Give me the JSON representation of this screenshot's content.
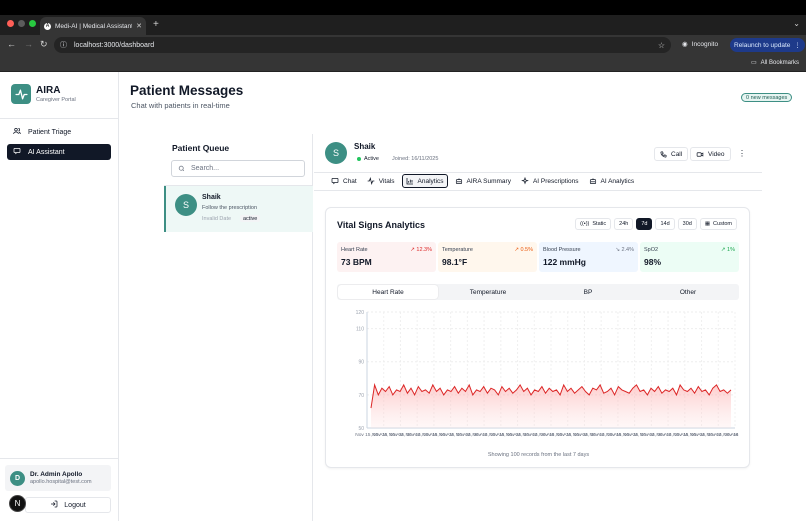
{
  "browser": {
    "tab_title": "Medi-AI | Medical Assistant D",
    "favicon_char": "A",
    "url": "localhost:3000/dashboard",
    "incognito_label": "Incognito",
    "relaunch_label": "Relaunch to update",
    "bookmarks_label": "All Bookmarks",
    "traffic_colors": [
      "#ff5f57",
      "#febc2e",
      "#28c840"
    ]
  },
  "sidebar": {
    "brand_name": "AIRA",
    "brand_sub": "Caregiver Portal",
    "items": [
      {
        "label": "Patient Triage",
        "icon": "users-icon",
        "active": false
      },
      {
        "label": "AI Assistant",
        "icon": "message-square-icon",
        "active": true
      }
    ],
    "user": {
      "initial": "D",
      "name": "Dr. Admin Apollo",
      "email": "apollo.hospital@test.com"
    },
    "logout_label": "Logout",
    "n_badge": "N"
  },
  "header": {
    "title": "Patient Messages",
    "subtitle": "Chat with patients in real-time",
    "new_messages": "0 new messages"
  },
  "queue": {
    "title": "Patient Queue",
    "search_placeholder": "Search...",
    "items": [
      {
        "initial": "S",
        "name": "Shaik",
        "message": "Follow the prescription",
        "date": "Invalid Date",
        "status": "active"
      }
    ]
  },
  "patient": {
    "initial": "S",
    "name": "Shaik",
    "status": "Active",
    "joined": "Joined: 16/11/2025",
    "call_label": "Call",
    "video_label": "Video"
  },
  "tabs": [
    {
      "label": "Chat",
      "icon": "chat-icon",
      "active": false
    },
    {
      "label": "Vitals",
      "icon": "activity-icon",
      "active": false
    },
    {
      "label": "Analytics",
      "icon": "bar-chart-icon",
      "active": true
    },
    {
      "label": "AIRA Summary",
      "icon": "bot-icon",
      "active": false
    },
    {
      "label": "AI Prescriptions",
      "icon": "sparkles-icon",
      "active": false
    },
    {
      "label": "AI Analytics",
      "icon": "bot-icon",
      "active": false
    }
  ],
  "analytics": {
    "title": "Vital Signs Analytics",
    "ranges": [
      {
        "label": "Static",
        "active": false
      },
      {
        "label": "24h",
        "active": false
      },
      {
        "label": "7d",
        "active": true
      },
      {
        "label": "14d",
        "active": false
      },
      {
        "label": "30d",
        "active": false
      },
      {
        "label": "Custom",
        "active": false
      }
    ],
    "metrics": [
      {
        "label": "Heart Rate",
        "change": "12.3%",
        "value": "73 BPM",
        "bg": "#fdf2f2",
        "change_color": "#dc2626",
        "trend": "up"
      },
      {
        "label": "Temperature",
        "change": "0.5%",
        "value": "98.1°F",
        "bg": "#fff7ed",
        "change_color": "#ea580c",
        "trend": "up"
      },
      {
        "label": "Blood Pressure",
        "change": "2.4%",
        "value": "122 mmHg",
        "bg": "#eff6ff",
        "change_color": "#6b7280",
        "trend": "down"
      },
      {
        "label": "SpO2",
        "change": "1%",
        "value": "98%",
        "bg": "#ecfdf5",
        "change_color": "#16a34a",
        "trend": "up"
      }
    ],
    "vital_tabs": [
      {
        "label": "Heart Rate",
        "active": true
      },
      {
        "label": "Temperature",
        "active": false
      },
      {
        "label": "BP",
        "active": false
      },
      {
        "label": "Other",
        "active": false
      }
    ],
    "footer": "Showing 100 records from the last 7 days"
  },
  "chart_data": {
    "type": "area",
    "series": [
      {
        "name": "",
        "color": "#dc2626",
        "values": [
          62,
          76,
          70,
          74,
          72,
          75,
          70,
          73,
          72,
          76,
          71,
          74,
          70,
          75,
          72,
          73,
          71,
          76,
          72,
          74,
          70,
          73,
          72,
          75,
          71,
          74,
          72,
          76,
          70,
          73,
          72,
          75,
          71,
          74,
          73,
          70,
          75,
          72,
          74,
          71,
          73,
          76,
          72,
          74,
          70,
          73,
          72,
          75,
          71,
          74,
          72,
          73,
          70,
          76,
          72,
          74,
          71,
          73,
          75,
          72,
          70,
          74,
          73,
          76,
          71,
          72,
          74,
          70,
          75,
          73,
          72,
          71,
          74,
          76,
          72,
          73,
          70,
          74,
          72,
          75,
          71,
          73,
          72,
          74,
          70,
          76,
          73,
          72,
          74,
          71,
          75,
          72,
          73,
          70,
          74,
          76,
          72,
          73,
          71,
          73
        ]
      }
    ],
    "ylim": [
      50,
      120
    ],
    "yticks": [
      50,
      70,
      90,
      110,
      120
    ],
    "xtick_labels": [
      "Nov 15, 05 AM",
      "Nov 15, 05 AM",
      "Nov 15, 05 AM",
      "Nov 15, 05 AM",
      "Nov 15, 05 AM",
      "Nov 15, 05 AM",
      "Nov 15, 05 AM",
      "Nov 15, 05 AM",
      "Nov 15, 05 AM",
      "Nov 15, 05 AM",
      "Nov 15, 05 AM",
      "Nov 15, 05 AM",
      "Nov 15, 05 AM",
      "Nov 15, 05 AM",
      "Nov 15, 05 AM",
      "Nov 15, 05 AM",
      "Nov 15, 05 AM",
      "Nov 15, 05 AM",
      "Nov 15, 05 AM",
      "Nov 15, 05 AM",
      "Nov 15, 05 AM",
      "Nov 15, 05 AM",
      "Nov 16, 05 AM"
    ],
    "grid": true,
    "xlabel": "",
    "ylabel": ""
  }
}
